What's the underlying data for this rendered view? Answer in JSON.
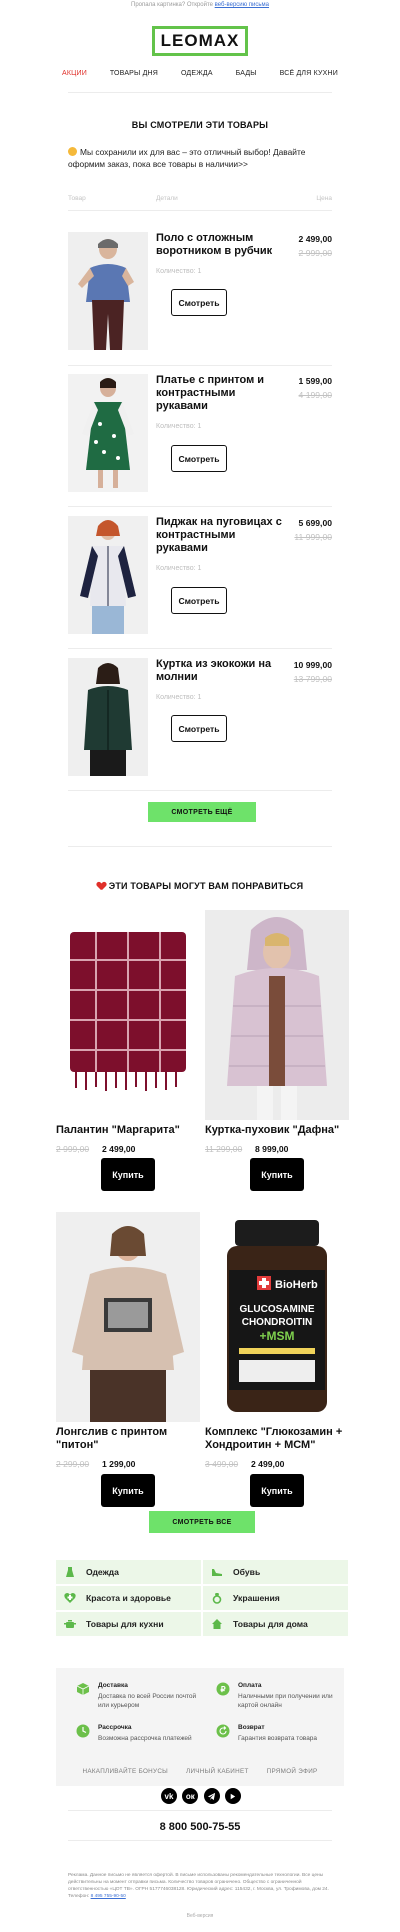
{
  "preheader": {
    "text": "Пропала картинка? Откройте",
    "link": "веб-версию письма"
  },
  "logo": "LEOMAX",
  "nav": [
    "АКЦИИ",
    "ТОВАРЫ ДНЯ",
    "ОДЕЖДА",
    "БАДЫ",
    "ВСЁ ДЛЯ КУХНИ"
  ],
  "viewed": {
    "title": "ВЫ СМОТРЕЛИ ЭТИ ТОВАРЫ",
    "intro": "Мы сохранили их для вас – это отличный выбор! Давайте оформим заказ, пока все товары в наличии>>",
    "columns": {
      "product": "Товар",
      "details": "Детали",
      "price": "Цена"
    },
    "items": [
      {
        "name": "Поло с отложным воротником в рубчик",
        "price": "2 499,00",
        "old_price": "2 999,00",
        "qty": "Количество: 1",
        "button": "Смотреть"
      },
      {
        "name": "Платье с принтом и контрастными рукавами",
        "price": "1 599,00",
        "old_price": "4 199,00",
        "qty": "Количество: 1",
        "button": "Смотреть"
      },
      {
        "name": "Пиджак на пуговицах с контрастными рукавами",
        "price": "5 699,00",
        "old_price": "11 999,00",
        "qty": "Количество: 1",
        "button": "Смотреть"
      },
      {
        "name": "Куртка из экокожи на молнии",
        "price": "10 999,00",
        "old_price": "13 799,00",
        "qty": "Количество: 1",
        "button": "Смотреть"
      }
    ],
    "more_button": "СМОТРЕТЬ ЕЩЁ"
  },
  "recommend": {
    "title": "ЭТИ ТОВАРЫ МОГУТ ВАМ ПОНРАВИТЬСЯ",
    "items": [
      {
        "name": "Палантин \"Маргарита\"",
        "old_price": "2 999,00",
        "price": "2 499,00",
        "button": "Купить"
      },
      {
        "name": "Куртка-пуховик \"Дафна\"",
        "old_price": "11 299,00",
        "price": "8 999,00",
        "button": "Купить"
      },
      {
        "name": "Лонгслив с принтом \"питон\"",
        "old_price": "2 299,00",
        "price": "1 299,00",
        "button": "Купить"
      },
      {
        "name": "Комплекс \"Глюкозамин + Хондроитин + МСМ\"",
        "old_price": "3 499,00",
        "price": "2 499,00",
        "button": "Купить"
      }
    ],
    "all_button": "СМОТРЕТЬ ВСЕ",
    "jar": {
      "brand": "BioHerb",
      "line1": "GLUCOSAMINE",
      "line2": "CHONDROITIN",
      "line3": "+MSM"
    }
  },
  "categories": [
    {
      "label": "Одежда",
      "icon": "dress-icon"
    },
    {
      "label": "Обувь",
      "icon": "shoe-icon"
    },
    {
      "label": "Красота и здоровье",
      "icon": "heart-plus-icon"
    },
    {
      "label": "Украшения",
      "icon": "ring-icon"
    },
    {
      "label": "Товары для кухни",
      "icon": "pot-icon"
    },
    {
      "label": "Товары для дома",
      "icon": "house-icon"
    }
  ],
  "info": [
    {
      "title": "Доставка",
      "text": "Доставка по всей России почтой или курьером",
      "icon": "box-icon"
    },
    {
      "title": "Оплата",
      "text": "Наличными при получении или картой онлайн",
      "icon": "ruble-icon"
    },
    {
      "title": "Рассрочка",
      "text": "Возможна рассрочка платежей",
      "icon": "clock-icon"
    },
    {
      "title": "Возврат",
      "text": "Гарантия возврата товара",
      "icon": "return-icon"
    }
  ],
  "footer_links": [
    "НАКАПЛИВАЙТЕ БОНУСЫ",
    "ЛИЧНЫЙ КАБИНЕТ",
    "ПРЯМОЙ ЭФИР"
  ],
  "social": [
    "vk",
    "ok",
    "telegram",
    "youtube"
  ],
  "phone": "8 800 500-75-55",
  "legal": {
    "text": "Реклама. Данное письмо не является офертой. В письме использованы рекомендательные технологии. Все цены действительны на момент отправки письма. Количество товаров ограничено. Общество с ограниченной ответственностью «ЦОТ ТВ». ОГРН 5177746038128. Юридический адрес: 115432, г. Москва, ул. Трофимова, дом 24. Телефон:",
    "phone_link": "8 495 755-90-50"
  },
  "web_version": "Веб-версия",
  "colors": {
    "accent_green": "#6ee26a",
    "logo_green": "#63c34a",
    "sale_red": "#e0302a",
    "category_bg": "#ecf7e8"
  }
}
